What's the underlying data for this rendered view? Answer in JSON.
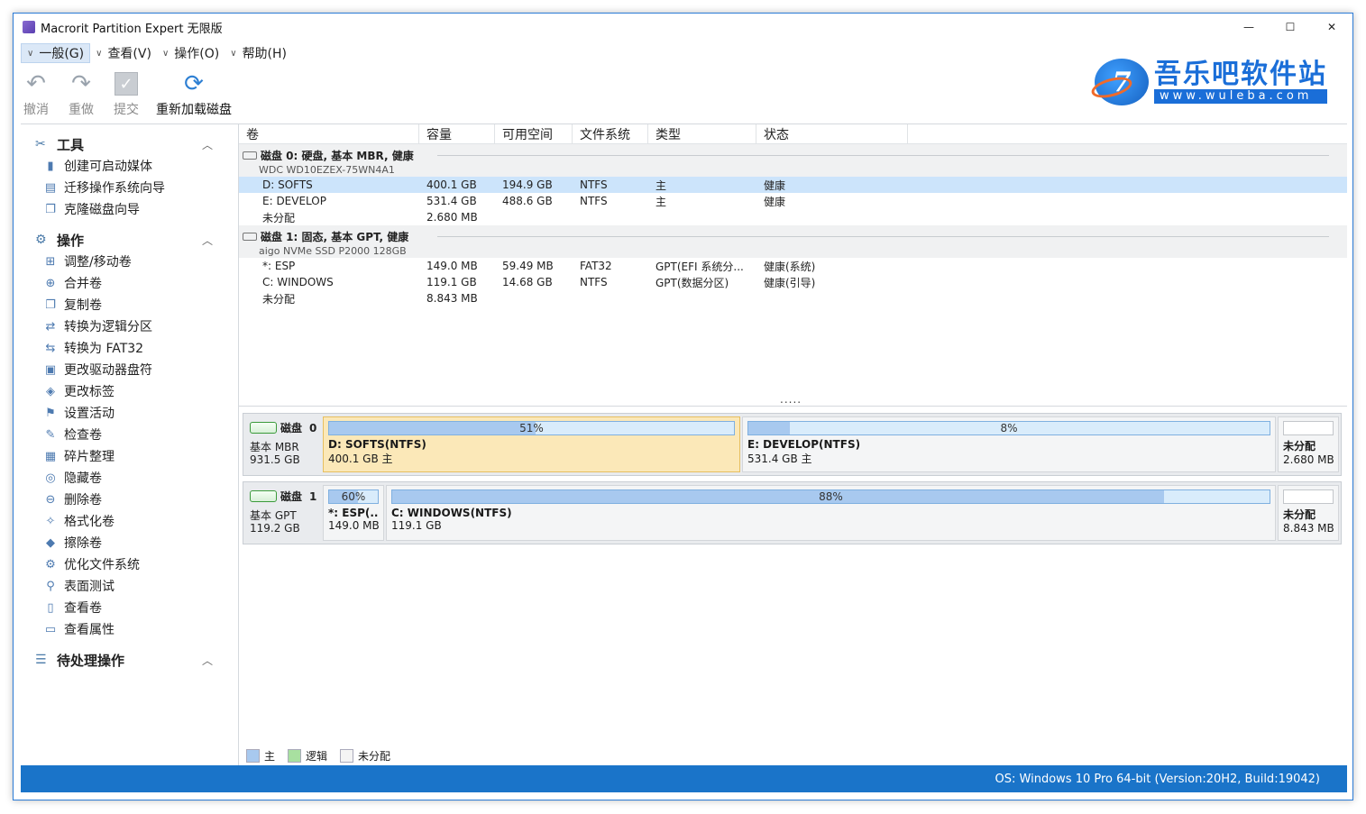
{
  "window": {
    "title": "Macrorit Partition Expert 无限版",
    "controls": [
      "—",
      "☐",
      "✕"
    ]
  },
  "menu": [
    {
      "label": "一般(G)"
    },
    {
      "label": "查看(V)"
    },
    {
      "label": "操作(O)"
    },
    {
      "label": "帮助(H)"
    }
  ],
  "toolbar": {
    "undo": "撤消",
    "redo": "重做",
    "commit": "提交",
    "reload": "重新加载磁盘"
  },
  "logo": {
    "cn": "吾乐吧软件站",
    "url": "www.wuleba.com"
  },
  "sidebar": {
    "tools": {
      "title": "工具",
      "items": [
        "创建可启动媒体",
        "迁移操作系统向导",
        "克隆磁盘向导"
      ]
    },
    "operations": {
      "title": "操作",
      "items": [
        "调整/移动卷",
        "合并卷",
        "复制卷",
        "转换为逻辑分区",
        "转换为 FAT32",
        "更改驱动器盘符",
        "更改标签",
        "设置活动",
        "检查卷",
        "碎片整理",
        "隐藏卷",
        "删除卷",
        "格式化卷",
        "擦除卷",
        "优化文件系统",
        "表面测试",
        "查看卷",
        "查看属性"
      ]
    },
    "pending": {
      "title": "待处理操作"
    }
  },
  "table": {
    "headers": [
      "卷",
      "容量",
      "可用空间",
      "文件系统",
      "类型",
      "状态"
    ],
    "disks": [
      {
        "title": "磁盘  0: 硬盘, 基本 MBR, 健康",
        "model": "WDC WD10EZEX-75WN4A1",
        "volumes": [
          {
            "name": "D: SOFTS",
            "capacity": "400.1 GB",
            "free": "194.9 GB",
            "fs": "NTFS",
            "type": "主",
            "status": "健康",
            "selected": true
          },
          {
            "name": "E: DEVELOP",
            "capacity": "531.4 GB",
            "free": "488.6 GB",
            "fs": "NTFS",
            "type": "主",
            "status": "健康"
          },
          {
            "name": "未分配",
            "capacity": "2.680 MB",
            "free": "",
            "fs": "",
            "type": "",
            "status": ""
          }
        ]
      },
      {
        "title": "磁盘  1: 固态, 基本 GPT, 健康",
        "model": "aigo NVMe SSD P2000 128GB",
        "volumes": [
          {
            "name": "*: ESP",
            "capacity": "149.0 MB",
            "free": "59.49 MB",
            "fs": "FAT32",
            "type": "GPT(EFI 系统分...",
            "status": "健康(系统)"
          },
          {
            "name": "C: WINDOWS",
            "capacity": "119.1 GB",
            "free": "14.68 GB",
            "fs": "NTFS",
            "type": "GPT(数据分区)",
            "status": "健康(引导)"
          },
          {
            "name": "未分配",
            "capacity": "8.843 MB",
            "free": "",
            "fs": "",
            "type": "",
            "status": ""
          }
        ]
      }
    ],
    "more": "....."
  },
  "diskmap": [
    {
      "label": "磁盘",
      "num": "0",
      "scheme": "基本 MBR",
      "size": "931.5 GB",
      "partitions": [
        {
          "pct": "51%",
          "fill": 0.51,
          "name": "D: SOFTS(NTFS)",
          "detail": "400.1 GB 主",
          "selected": true
        },
        {
          "pct": "8%",
          "fill": 0.08,
          "name": "E: DEVELOP(NTFS)",
          "detail": "531.4 GB 主"
        },
        {
          "pct": "",
          "fill": 0,
          "name": "未分配",
          "detail": "2.680 MB",
          "unalloc": true
        }
      ]
    },
    {
      "label": "磁盘",
      "num": "1",
      "scheme": "基本 GPT",
      "size": "119.2 GB",
      "partitions": [
        {
          "pct": "60%",
          "fill": 0.6,
          "name": "*: ESP(...",
          "detail": "149.0 MB"
        },
        {
          "pct": "88%",
          "fill": 0.88,
          "name": "C: WINDOWS(NTFS)",
          "detail": "119.1 GB"
        },
        {
          "pct": "",
          "fill": 0,
          "name": "未分配",
          "detail": "8.843 MB",
          "unalloc": true
        }
      ]
    }
  ],
  "legend": [
    {
      "label": "主",
      "color": "#a8c9ef"
    },
    {
      "label": "逻辑",
      "color": "#a8e0a0"
    },
    {
      "label": "未分配",
      "color": "#f4f4f4"
    }
  ],
  "status": {
    "os": "OS: Windows 10 Pro 64-bit (Version:20H2, Build:19042)"
  }
}
